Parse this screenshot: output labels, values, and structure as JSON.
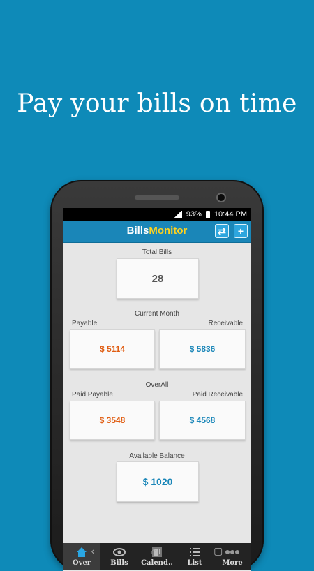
{
  "headline": "Pay your bills on time",
  "status": {
    "battery": "93%",
    "time": "10:44 PM"
  },
  "app": {
    "title_part1": "Bills",
    "title_part2": "Monitor",
    "refresh_icon": "refresh-icon",
    "add_icon": "plus-icon"
  },
  "overview": {
    "total_bills_label": "Total Bills",
    "total_bills_value": "28",
    "current_month_label": "Current Month",
    "payable_label": "Payable",
    "receivable_label": "Receivable",
    "payable_value": "$ 5114",
    "receivable_value": "$ 5836",
    "overall_label": "OverAll",
    "paid_payable_label": "Paid Payable",
    "paid_receivable_label": "Paid Receivable",
    "paid_payable_value": "$ 3548",
    "paid_receivable_value": "$ 4568",
    "available_balance_label": "Available Balance",
    "available_balance_value": "$ 1020"
  },
  "nav": [
    {
      "label": "Over",
      "icon": "home-icon",
      "active": true
    },
    {
      "label": "Bills",
      "icon": "eye-icon",
      "active": false
    },
    {
      "label": "Calend..",
      "icon": "calendar-icon",
      "active": false
    },
    {
      "label": "List",
      "icon": "list-icon",
      "active": false
    },
    {
      "label": "More",
      "icon": "more-icon",
      "active": false
    }
  ],
  "system_nav": [
    "back-icon",
    "home-icon",
    "recents-icon"
  ],
  "colors": {
    "background": "#0e8ab8",
    "appbar": "#1a86b8",
    "payable": "#e05d12",
    "receivable": "#1a86b8",
    "logo_accent": "#ffd21f"
  }
}
